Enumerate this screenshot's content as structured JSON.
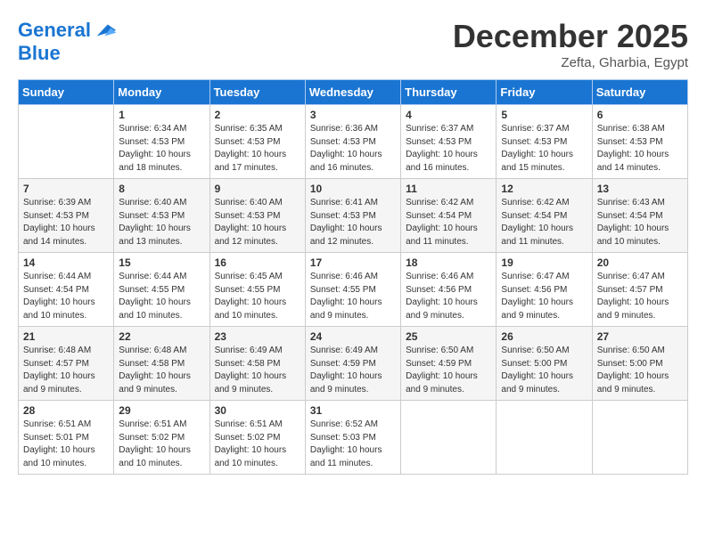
{
  "header": {
    "logo_line1": "General",
    "logo_line2": "Blue",
    "month": "December 2025",
    "location": "Zefta, Gharbia, Egypt"
  },
  "days_of_week": [
    "Sunday",
    "Monday",
    "Tuesday",
    "Wednesday",
    "Thursday",
    "Friday",
    "Saturday"
  ],
  "weeks": [
    [
      {
        "day": "",
        "info": ""
      },
      {
        "day": "1",
        "info": "Sunrise: 6:34 AM\nSunset: 4:53 PM\nDaylight: 10 hours\nand 18 minutes."
      },
      {
        "day": "2",
        "info": "Sunrise: 6:35 AM\nSunset: 4:53 PM\nDaylight: 10 hours\nand 17 minutes."
      },
      {
        "day": "3",
        "info": "Sunrise: 6:36 AM\nSunset: 4:53 PM\nDaylight: 10 hours\nand 16 minutes."
      },
      {
        "day": "4",
        "info": "Sunrise: 6:37 AM\nSunset: 4:53 PM\nDaylight: 10 hours\nand 16 minutes."
      },
      {
        "day": "5",
        "info": "Sunrise: 6:37 AM\nSunset: 4:53 PM\nDaylight: 10 hours\nand 15 minutes."
      },
      {
        "day": "6",
        "info": "Sunrise: 6:38 AM\nSunset: 4:53 PM\nDaylight: 10 hours\nand 14 minutes."
      }
    ],
    [
      {
        "day": "7",
        "info": "Sunrise: 6:39 AM\nSunset: 4:53 PM\nDaylight: 10 hours\nand 14 minutes."
      },
      {
        "day": "8",
        "info": "Sunrise: 6:40 AM\nSunset: 4:53 PM\nDaylight: 10 hours\nand 13 minutes."
      },
      {
        "day": "9",
        "info": "Sunrise: 6:40 AM\nSunset: 4:53 PM\nDaylight: 10 hours\nand 12 minutes."
      },
      {
        "day": "10",
        "info": "Sunrise: 6:41 AM\nSunset: 4:53 PM\nDaylight: 10 hours\nand 12 minutes."
      },
      {
        "day": "11",
        "info": "Sunrise: 6:42 AM\nSunset: 4:54 PM\nDaylight: 10 hours\nand 11 minutes."
      },
      {
        "day": "12",
        "info": "Sunrise: 6:42 AM\nSunset: 4:54 PM\nDaylight: 10 hours\nand 11 minutes."
      },
      {
        "day": "13",
        "info": "Sunrise: 6:43 AM\nSunset: 4:54 PM\nDaylight: 10 hours\nand 10 minutes."
      }
    ],
    [
      {
        "day": "14",
        "info": "Sunrise: 6:44 AM\nSunset: 4:54 PM\nDaylight: 10 hours\nand 10 minutes."
      },
      {
        "day": "15",
        "info": "Sunrise: 6:44 AM\nSunset: 4:55 PM\nDaylight: 10 hours\nand 10 minutes."
      },
      {
        "day": "16",
        "info": "Sunrise: 6:45 AM\nSunset: 4:55 PM\nDaylight: 10 hours\nand 10 minutes."
      },
      {
        "day": "17",
        "info": "Sunrise: 6:46 AM\nSunset: 4:55 PM\nDaylight: 10 hours\nand 9 minutes."
      },
      {
        "day": "18",
        "info": "Sunrise: 6:46 AM\nSunset: 4:56 PM\nDaylight: 10 hours\nand 9 minutes."
      },
      {
        "day": "19",
        "info": "Sunrise: 6:47 AM\nSunset: 4:56 PM\nDaylight: 10 hours\nand 9 minutes."
      },
      {
        "day": "20",
        "info": "Sunrise: 6:47 AM\nSunset: 4:57 PM\nDaylight: 10 hours\nand 9 minutes."
      }
    ],
    [
      {
        "day": "21",
        "info": "Sunrise: 6:48 AM\nSunset: 4:57 PM\nDaylight: 10 hours\nand 9 minutes."
      },
      {
        "day": "22",
        "info": "Sunrise: 6:48 AM\nSunset: 4:58 PM\nDaylight: 10 hours\nand 9 minutes."
      },
      {
        "day": "23",
        "info": "Sunrise: 6:49 AM\nSunset: 4:58 PM\nDaylight: 10 hours\nand 9 minutes."
      },
      {
        "day": "24",
        "info": "Sunrise: 6:49 AM\nSunset: 4:59 PM\nDaylight: 10 hours\nand 9 minutes."
      },
      {
        "day": "25",
        "info": "Sunrise: 6:50 AM\nSunset: 4:59 PM\nDaylight: 10 hours\nand 9 minutes."
      },
      {
        "day": "26",
        "info": "Sunrise: 6:50 AM\nSunset: 5:00 PM\nDaylight: 10 hours\nand 9 minutes."
      },
      {
        "day": "27",
        "info": "Sunrise: 6:50 AM\nSunset: 5:00 PM\nDaylight: 10 hours\nand 9 minutes."
      }
    ],
    [
      {
        "day": "28",
        "info": "Sunrise: 6:51 AM\nSunset: 5:01 PM\nDaylight: 10 hours\nand 10 minutes."
      },
      {
        "day": "29",
        "info": "Sunrise: 6:51 AM\nSunset: 5:02 PM\nDaylight: 10 hours\nand 10 minutes."
      },
      {
        "day": "30",
        "info": "Sunrise: 6:51 AM\nSunset: 5:02 PM\nDaylight: 10 hours\nand 10 minutes."
      },
      {
        "day": "31",
        "info": "Sunrise: 6:52 AM\nSunset: 5:03 PM\nDaylight: 10 hours\nand 11 minutes."
      },
      {
        "day": "",
        "info": ""
      },
      {
        "day": "",
        "info": ""
      },
      {
        "day": "",
        "info": ""
      }
    ]
  ]
}
